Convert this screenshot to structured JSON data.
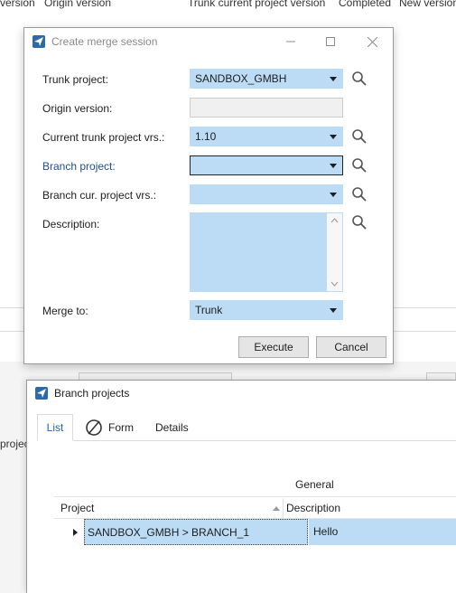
{
  "background": {
    "columns": [
      "version",
      "Origin version",
      "Trunk current project version",
      "Completed",
      "New version"
    ],
    "truncated_label": "projec"
  },
  "merge_dialog": {
    "title": "Create merge session",
    "fields": {
      "trunk_project": {
        "label": "Trunk project:",
        "value": "SANDBOX_GMBH"
      },
      "origin_version": {
        "label": "Origin version:",
        "value": ""
      },
      "current_trunk_version": {
        "label": "Current trunk project vrs.:",
        "value": "1.10"
      },
      "branch_project": {
        "label": "Branch project:",
        "value": ""
      },
      "branch_cur_version": {
        "label": "Branch cur. project vrs.:",
        "value": ""
      },
      "description": {
        "label": "Description:",
        "value": ""
      },
      "merge_to": {
        "label": "Merge to:",
        "value": "Trunk"
      }
    },
    "buttons": {
      "execute": "Execute",
      "cancel": "Cancel"
    },
    "icons": [
      "window-icon",
      "minimize-icon",
      "maximize-icon",
      "close-icon",
      "search-icon",
      "dropdown-arrow-icon"
    ]
  },
  "branch_window": {
    "title": "Branch projects",
    "tabs": [
      {
        "label": "List",
        "active": true
      },
      {
        "label": "Form",
        "icon": "form-icon"
      },
      {
        "label": "Details"
      }
    ],
    "group_header": "General",
    "columns": [
      "Project",
      "Description"
    ],
    "rows": [
      {
        "project": "SANDBOX_GMBH > BRANCH_1",
        "description": "Hello",
        "selected": true
      }
    ]
  },
  "colors": {
    "selection_blue": "#bcdcf6",
    "accent_blue": "#2e6aa8",
    "link_blue": "#1f4f8f",
    "tab_active_text": "#1e64b4"
  }
}
